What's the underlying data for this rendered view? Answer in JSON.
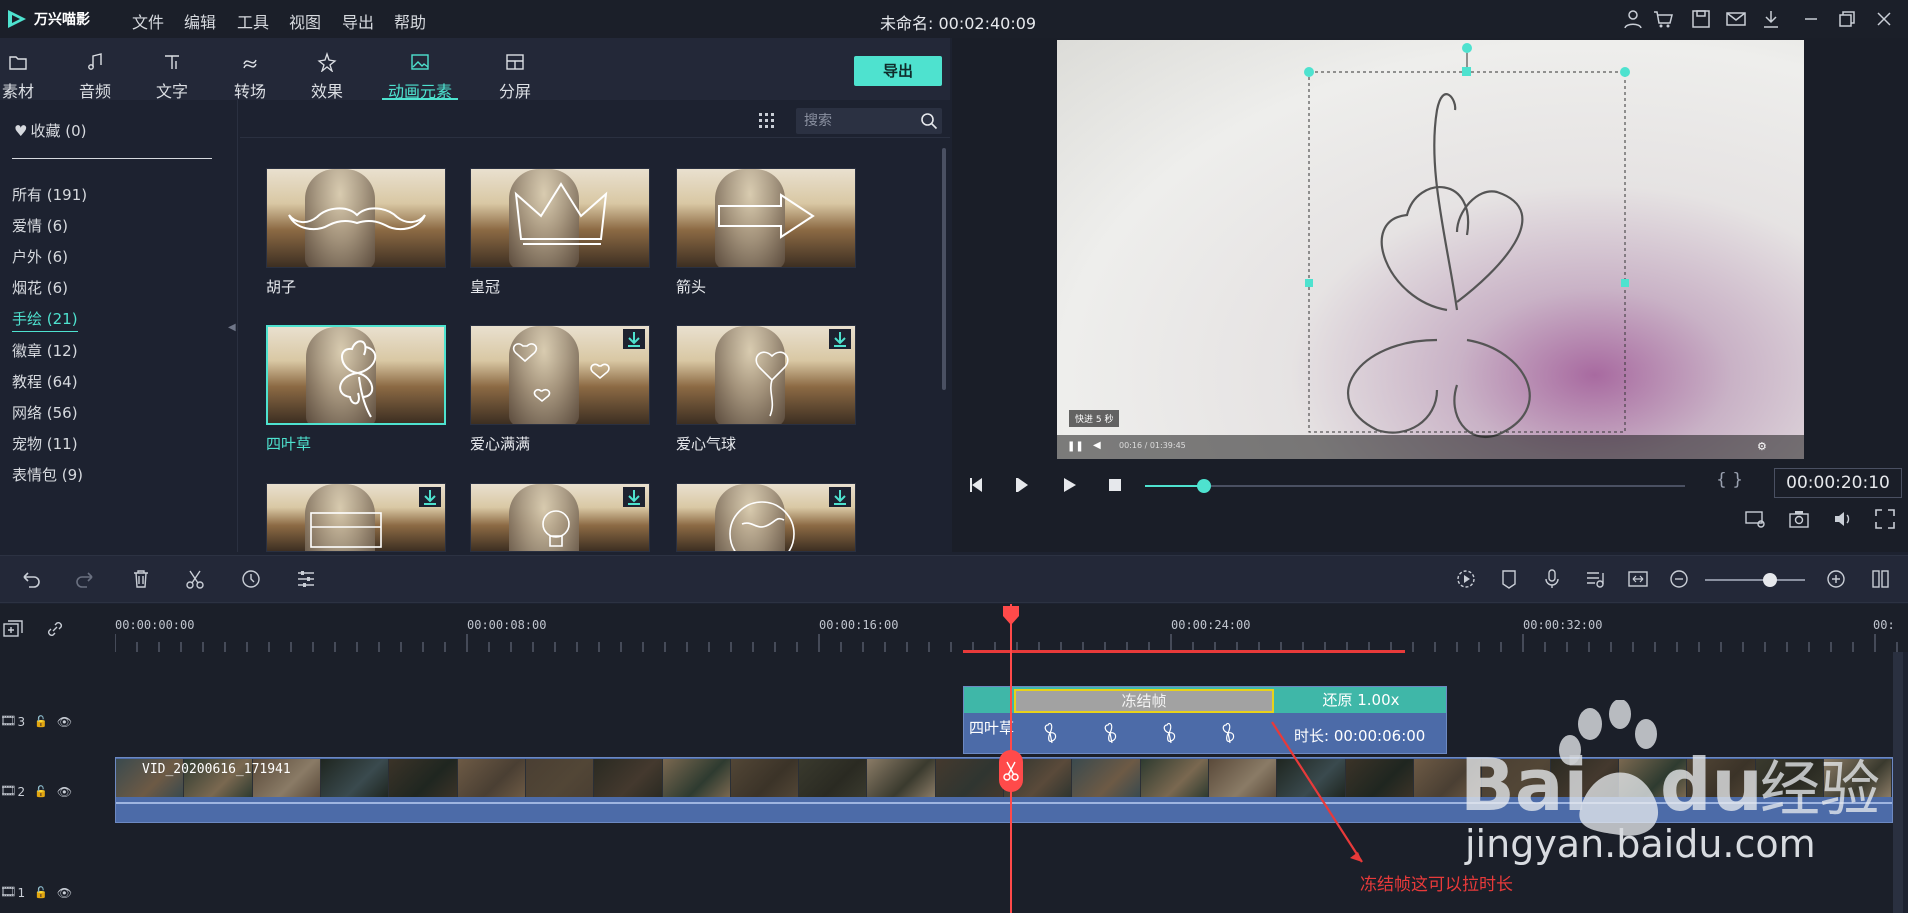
{
  "app": {
    "name": "万兴喵影",
    "doc_title": "未命名: 00:02:40:09"
  },
  "menu": [
    "文件",
    "编辑",
    "工具",
    "视图",
    "导出",
    "帮助"
  ],
  "lib_tabs": [
    {
      "label": "素材",
      "icon": "folder-icon"
    },
    {
      "label": "音频",
      "icon": "music-note-icon"
    },
    {
      "label": "文字",
      "icon": "text-icon"
    },
    {
      "label": "转场",
      "icon": "transition-icon"
    },
    {
      "label": "效果",
      "icon": "effects-icon"
    },
    {
      "label": "动画元素",
      "icon": "image-icon",
      "active": true
    },
    {
      "label": "分屏",
      "icon": "split-screen-icon"
    }
  ],
  "export_label": "导出",
  "favorites": "收藏 (0)",
  "categories": [
    {
      "label": "所有 (191)"
    },
    {
      "label": "爱情 (6)"
    },
    {
      "label": "户外 (6)"
    },
    {
      "label": "烟花 (6)"
    },
    {
      "label": "手绘 (21)",
      "active": true
    },
    {
      "label": "徽章 (12)"
    },
    {
      "label": "教程 (64)"
    },
    {
      "label": "网络 (56)"
    },
    {
      "label": "宠物 (11)"
    },
    {
      "label": "表情包 (9)"
    }
  ],
  "search": {
    "placeholder": "搜索"
  },
  "thumbs": [
    {
      "label": "胡子",
      "downloadable": false
    },
    {
      "label": "皇冠",
      "downloadable": false
    },
    {
      "label": "箭头",
      "downloadable": false
    },
    {
      "label": "四叶草",
      "downloadable": false,
      "selected": true
    },
    {
      "label": "爱心满满",
      "downloadable": true
    },
    {
      "label": "爱心气球",
      "downloadable": true
    },
    {
      "label": "",
      "downloadable": true
    },
    {
      "label": "",
      "downloadable": true
    },
    {
      "label": "",
      "downloadable": true
    }
  ],
  "preview": {
    "speed_badge": "快进 5 秒",
    "video_time": "00:16 / 01:39:45",
    "timecode": "00:00:20:10",
    "braces": "{ }",
    "scrub_fraction": 0.11
  },
  "ruler": [
    "00:00:00:00",
    "00:00:08:00",
    "00:00:16:00",
    "00:00:24:00",
    "00:00:32:00",
    "00:"
  ],
  "tracks": [
    {
      "num": "3"
    },
    {
      "num": "2"
    },
    {
      "num": "1"
    }
  ],
  "clip_four": {
    "name": "四叶草",
    "freeze": "冻结帧",
    "restore": "还原 1.00x",
    "duration": "时长: 00:00:06:00"
  },
  "video_clip": {
    "name": "VID_20200616_171941"
  },
  "annotation": "冻结帧这可以拉时长",
  "watermark": {
    "text": "jingyan.baidu.com",
    "brand": "Baidu经验"
  },
  "colors": {
    "accent": "#4ee2cf",
    "playhead": "#ff4a4a",
    "freeze_border": "#e8d21a"
  },
  "zoom_fraction": 0.65
}
